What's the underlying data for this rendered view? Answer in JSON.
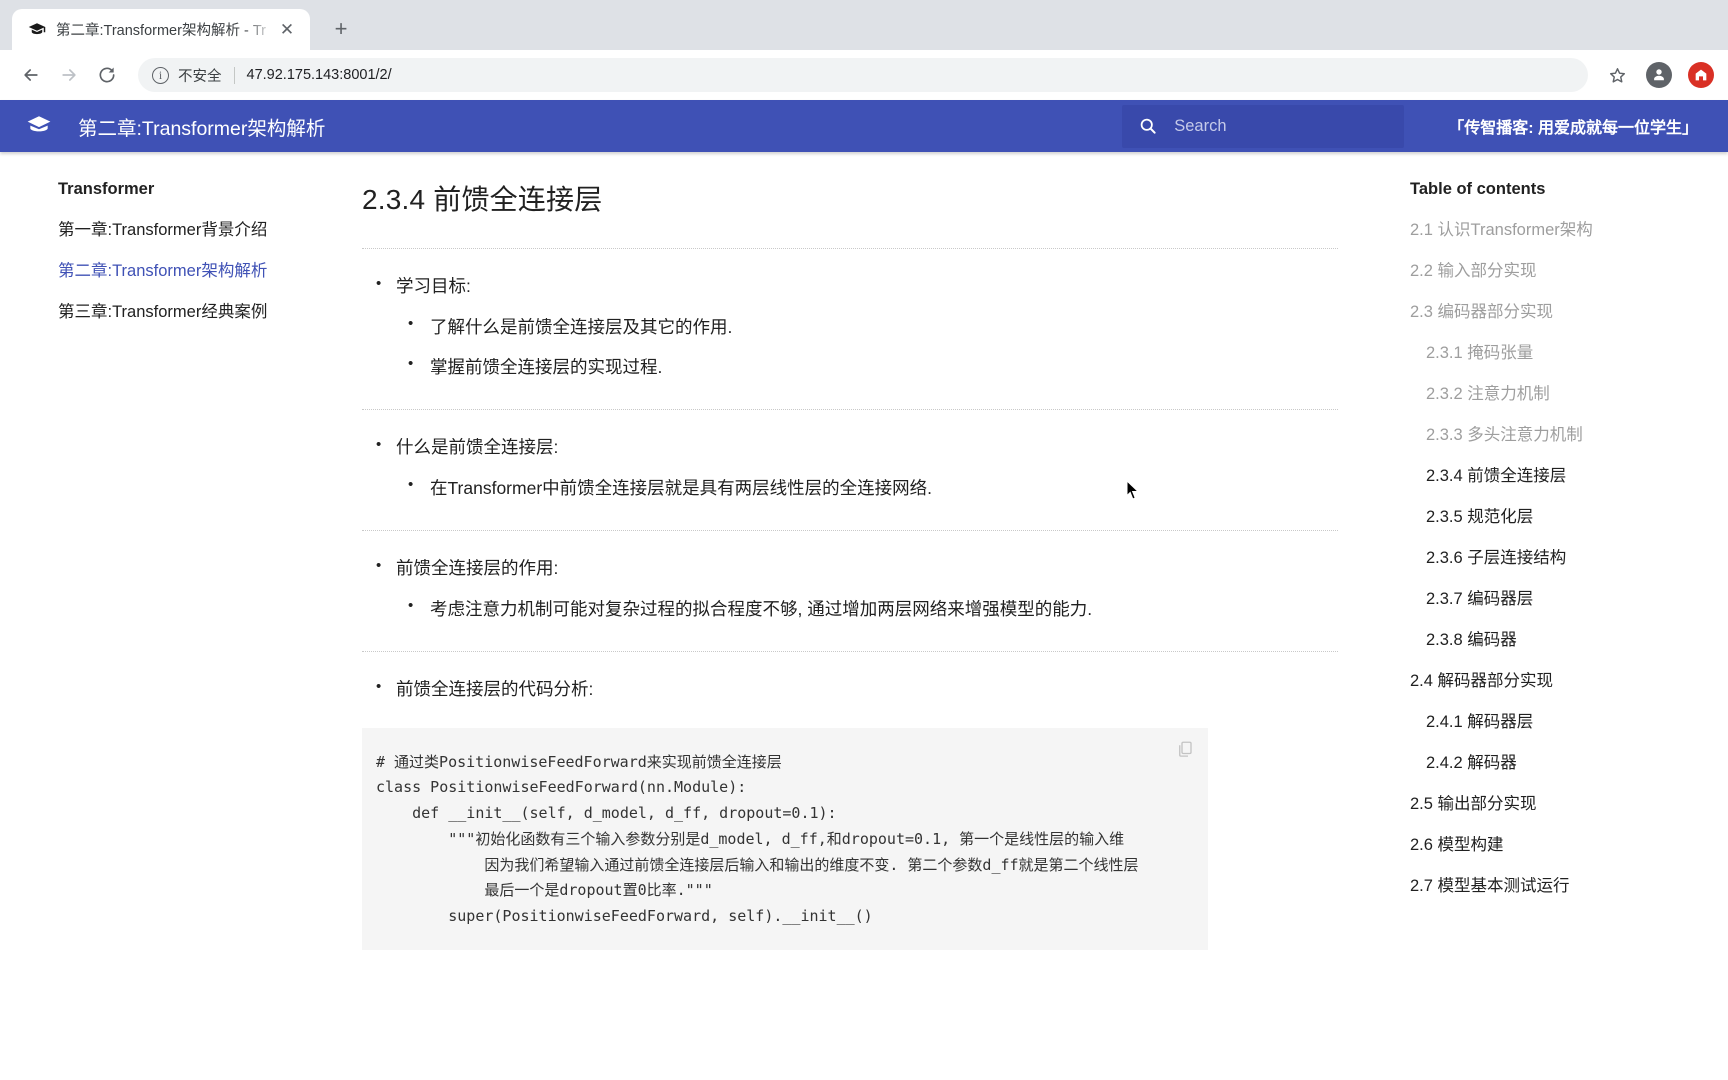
{
  "browser": {
    "tab": {
      "title": "第二章:Transformer架构解析 - Tr",
      "favicon": "graduation-cap-icon",
      "close": "✕"
    },
    "newtab_label": "+",
    "nav": {
      "back": "←",
      "forward": "→",
      "reload": "⟳"
    },
    "omnibox": {
      "info_label": "i",
      "security_text": "不安全",
      "url_host": "47.92.175.143",
      "url_path": ":8001/2/"
    },
    "bookmark_label": "☆"
  },
  "header": {
    "logo": "book-stack-icon",
    "title": "第二章:Transformer架构解析",
    "search_placeholder": "Search",
    "tagline": "「传智播客: 用爱成就每一位学生」",
    "accent_color": "#3f51b5",
    "search_bg": "#3949ab"
  },
  "sidebar": {
    "title": "Transformer",
    "items": [
      {
        "label": "第一章:Transformer背景介绍",
        "active": false
      },
      {
        "label": "第二章:Transformer架构解析",
        "active": true
      },
      {
        "label": "第三章:Transformer经典案例",
        "active": false
      }
    ]
  },
  "main": {
    "heading": "2.3.4 前馈全连接层",
    "sections": [
      {
        "title": "学习目标:",
        "items": [
          "了解什么是前馈全连接层及其它的作用.",
          "掌握前馈全连接层的实现过程."
        ]
      },
      {
        "title": "什么是前馈全连接层:",
        "items": [
          "在Transformer中前馈全连接层就是具有两层线性层的全连接网络."
        ]
      },
      {
        "title": "前馈全连接层的作用:",
        "items": [
          "考虑注意力机制可能对复杂过程的拟合程度不够, 通过增加两层网络来增强模型的能力."
        ]
      },
      {
        "title": "前馈全连接层的代码分析:",
        "items": []
      }
    ],
    "code": "# 通过类PositionwiseFeedForward来实现前馈全连接层\nclass PositionwiseFeedForward(nn.Module):\n    def __init__(self, d_model, d_ff, dropout=0.1):\n        \"\"\"初始化函数有三个输入参数分别是d_model, d_ff,和dropout=0.1, 第一个是线性层的输入维\n            因为我们希望输入通过前馈全连接层后输入和输出的维度不变. 第二个参数d_ff就是第二个线性层\n            最后一个是dropout置0比率.\"\"\"\n        super(PositionwiseFeedForward, self).__init__()",
    "copy_icon": "copy-icon"
  },
  "toc": {
    "title": "Table of contents",
    "items": [
      {
        "label": "2.1 认识Transformer架构",
        "level": 2,
        "current": false
      },
      {
        "label": "2.2 输入部分实现",
        "level": 2,
        "current": false
      },
      {
        "label": "2.3 编码器部分实现",
        "level": 2,
        "current": false
      },
      {
        "label": "2.3.1 掩码张量",
        "level": 3,
        "current": false
      },
      {
        "label": "2.3.2 注意力机制",
        "level": 3,
        "current": false
      },
      {
        "label": "2.3.3 多头注意力机制",
        "level": 3,
        "current": false
      },
      {
        "label": "2.3.4 前馈全连接层",
        "level": 3,
        "current": true
      },
      {
        "label": "2.3.5 规范化层",
        "level": 3,
        "current": true
      },
      {
        "label": "2.3.6 子层连接结构",
        "level": 3,
        "current": true
      },
      {
        "label": "2.3.7 编码器层",
        "level": 3,
        "current": true
      },
      {
        "label": "2.3.8 编码器",
        "level": 3,
        "current": true
      },
      {
        "label": "2.4 解码器部分实现",
        "level": 2,
        "current": true
      },
      {
        "label": "2.4.1 解码器层",
        "level": 3,
        "current": true
      },
      {
        "label": "2.4.2 解码器",
        "level": 3,
        "current": true
      },
      {
        "label": "2.5 输出部分实现",
        "level": 2,
        "current": true
      },
      {
        "label": "2.6 模型构建",
        "level": 2,
        "current": true
      },
      {
        "label": "2.7 模型基本测试运行",
        "level": 2,
        "current": true
      }
    ]
  }
}
